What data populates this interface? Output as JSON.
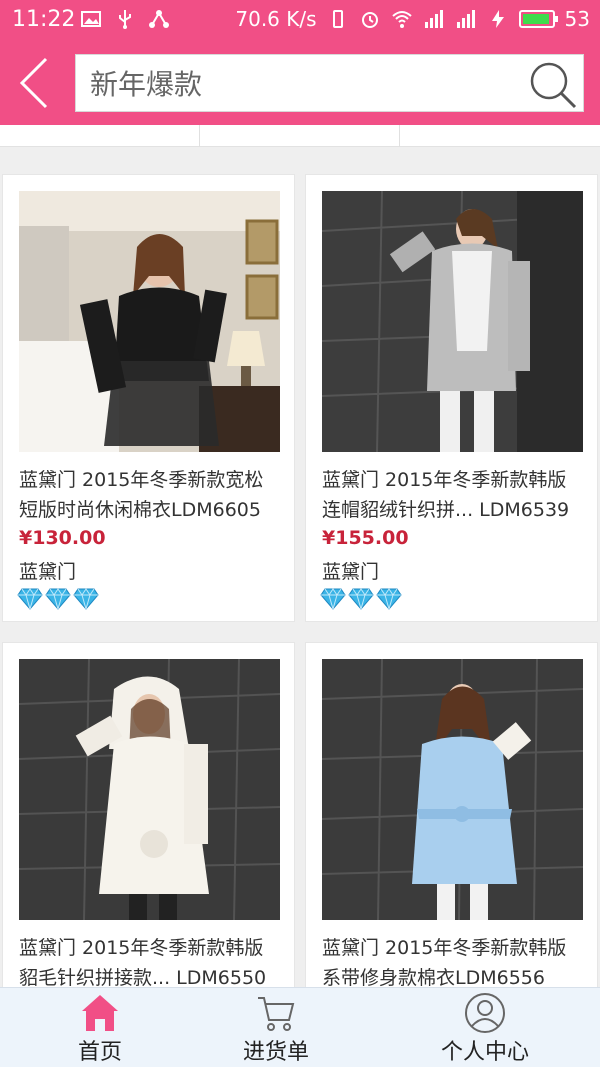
{
  "status_bar": {
    "time": "11:22",
    "net_speed": "70.6 K/s",
    "battery_level": "53"
  },
  "search": {
    "value": "新年爆款"
  },
  "products": [
    {
      "title": "蓝黛门 2015年冬季新款宽松短版时尚休闲棉衣LDM6605",
      "price": "¥130.00",
      "brand": "蓝黛门",
      "gems": 3
    },
    {
      "title": "蓝黛门 2015年冬季新款韩版连帽貂绒针织拼... LDM6539",
      "price": "¥155.00",
      "brand": "蓝黛门",
      "gems": 3
    },
    {
      "title": "蓝黛门 2015年冬季新款韩版貂毛针织拼接款... LDM6550"
    },
    {
      "title": "蓝黛门 2015年冬季新款韩版系带修身款棉衣LDM6556"
    }
  ],
  "bottom_nav": {
    "items": [
      {
        "label": "首页",
        "icon": "home-icon",
        "active": true
      },
      {
        "label": "进货单",
        "icon": "cart-icon",
        "active": false
      },
      {
        "label": "个人中心",
        "icon": "user-icon",
        "active": false
      }
    ]
  },
  "colors": {
    "brand_pink": "#f14f86",
    "price_red": "#c8233a",
    "gem_blue": "#3ab4e6"
  }
}
